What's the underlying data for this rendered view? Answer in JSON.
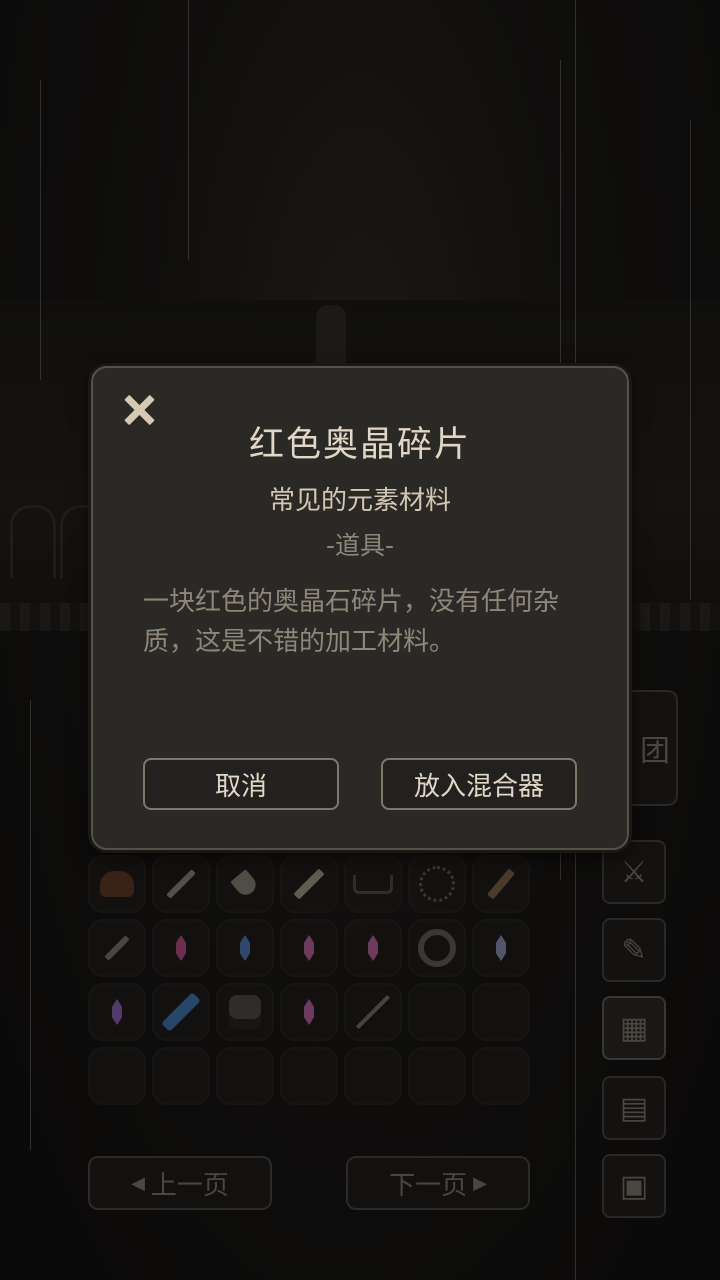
{
  "dialog": {
    "title": "红色奥晶碎片",
    "subtitle": "常见的元素材料",
    "category": "-道具-",
    "description": "一块红色的奥晶石碎片，没有任何杂质，这是不错的加工材料。",
    "cancel_label": "取消",
    "confirm_label": "放入混合器"
  },
  "inventory": {
    "slots": [
      "hair-icon",
      "sword-icon",
      "shovel-icon",
      "blade-icon",
      "hanger-icon",
      "necklace-icon",
      "dagger-icon",
      "knife-icon",
      "crystal-red-icon",
      "crystal-blue-icon",
      "crystal-pink-icon",
      "crystal-pink-icon",
      "amulet-icon",
      "crystal-gray-icon",
      "crystal-purple-icon",
      "greatsword-icon",
      "mask-icon",
      "crystal-pink-icon",
      "staff-icon",
      "empty",
      "empty",
      "empty",
      "empty",
      "empty",
      "empty",
      "empty",
      "empty",
      "empty"
    ]
  },
  "pager": {
    "prev_label": "上一页",
    "next_label": "下一页"
  },
  "side_panel": {
    "close_label": "团"
  }
}
